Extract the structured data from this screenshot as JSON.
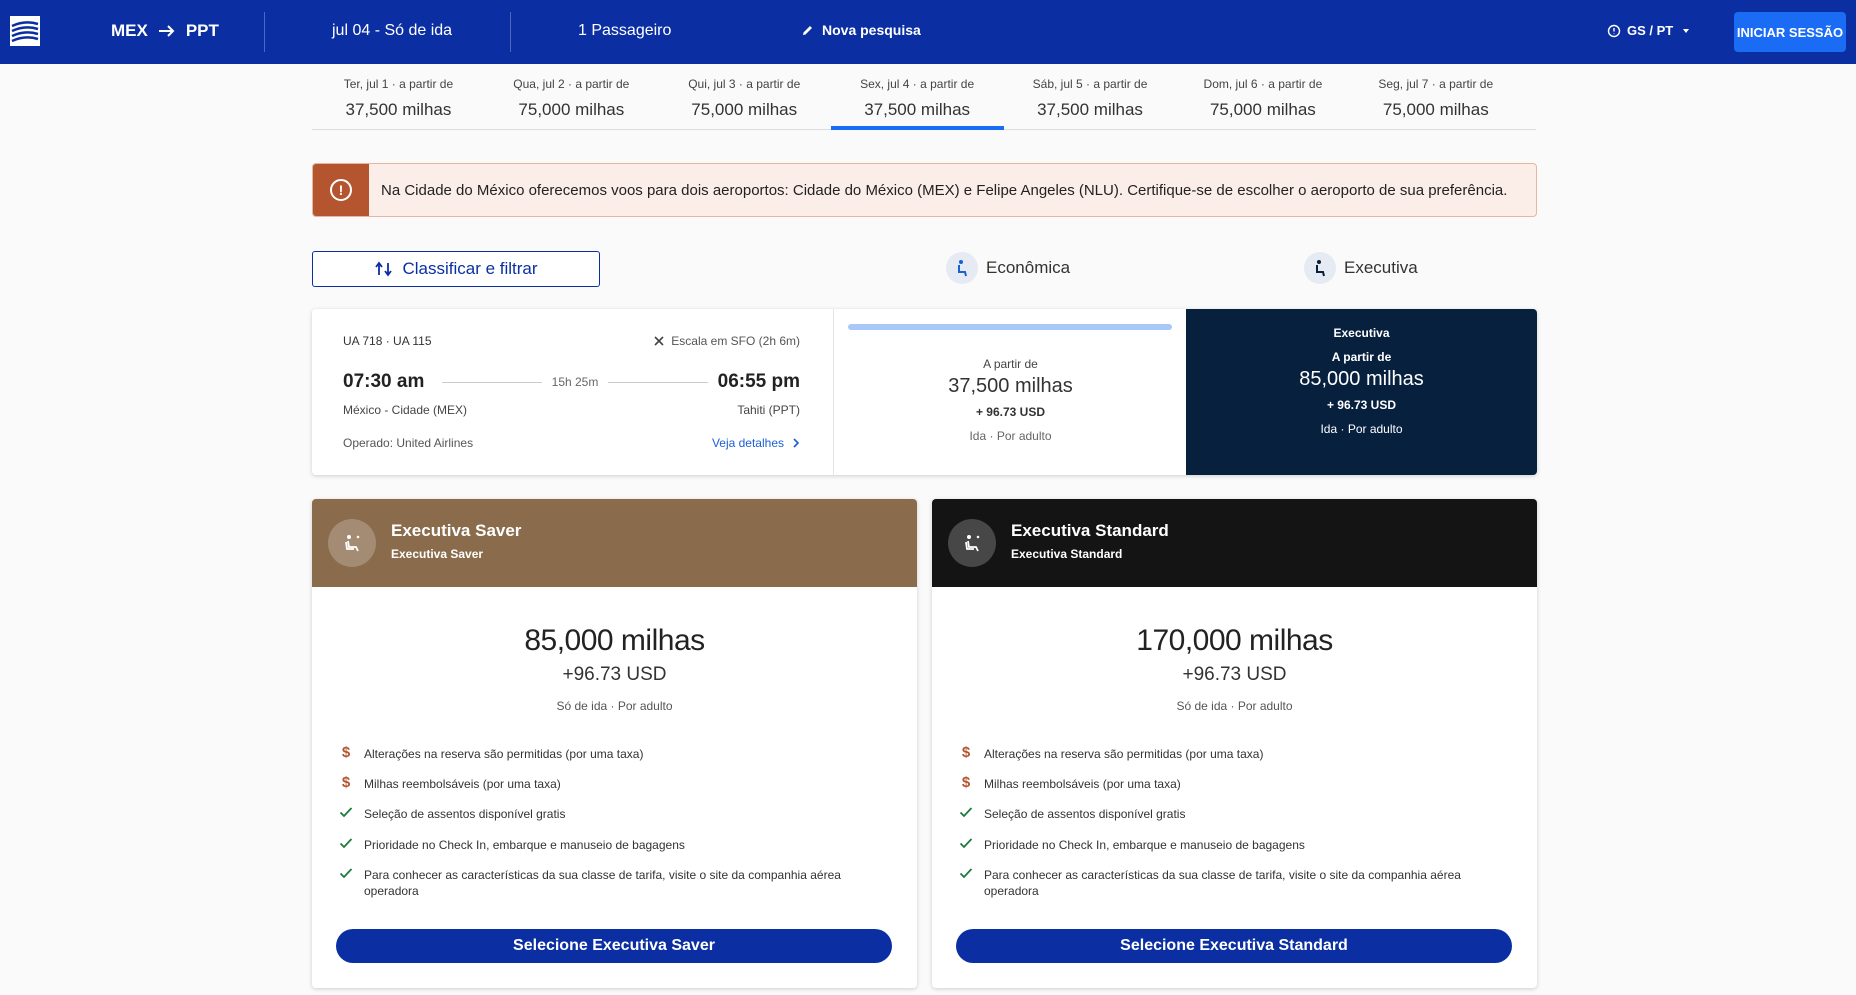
{
  "topbar": {
    "origin": "MEX",
    "destination": "PPT",
    "date_label": "jul 04 - Só de ida",
    "passengers": "1 Passageiro",
    "new_search": "Nova pesquisa",
    "locale": "GS / PT",
    "login": "INICIAR SESSÃO",
    "colors": {
      "bar": "#0b2fa3",
      "login": "#1a6cf5"
    }
  },
  "dates": [
    {
      "label": "Ter, jul 1 · a partir de",
      "miles": "37,500 milhas",
      "active": false
    },
    {
      "label": "Qua, jul 2 · a partir de",
      "miles": "75,000 milhas",
      "active": false
    },
    {
      "label": "Qui, jul 3 · a partir de",
      "miles": "75,000 milhas",
      "active": false
    },
    {
      "label": "Sex, jul 4 · a partir de",
      "miles": "37,500 milhas",
      "active": true
    },
    {
      "label": "Sáb, jul 5 · a partir de",
      "miles": "37,500 milhas",
      "active": false
    },
    {
      "label": "Dom, jul 6 · a partir de",
      "miles": "75,000 milhas",
      "active": false
    },
    {
      "label": "Seg, jul 7 · a partir de",
      "miles": "75,000 milhas",
      "active": false
    }
  ],
  "alert": {
    "text": "Na Cidade do México oferecemos voos para dois aeroportos: Cidade do México (MEX) e Felipe Angeles (NLU). Certifique-se de escolher o aeroporto de sua preferência.",
    "icon": "exclamation-circle-icon"
  },
  "controls": {
    "sort_filter": "Classificar e filtrar",
    "cabin_economy": "Econômica",
    "cabin_executive": "Executiva"
  },
  "flight": {
    "flights": "UA 718 · UA 115",
    "stop": "Escala em SFO (2h 6m)",
    "departure_time": "07:30 am",
    "arrival_time": "06:55 pm",
    "duration": "15h 25m",
    "from": "México - Cidade (MEX)",
    "to": "Tahiti (PPT)",
    "operated_by": "Operado: United Airlines",
    "details_link": "Veja detalhes",
    "economy": {
      "from_label": "A partir de",
      "miles": "37,500 milhas",
      "usd": "+ 96.73 USD",
      "sub": "Ida · Por adulto"
    },
    "executive": {
      "title": "Executiva",
      "from_label": "A partir de",
      "miles": "85,000 milhas",
      "usd": "+ 96.73 USD",
      "sub": "Ida · Por adulto"
    }
  },
  "fares": [
    {
      "title": "Executiva Saver",
      "subtitle": "Executiva Saver",
      "header_color": "#8a6c4c",
      "miles": "85,000 milhas",
      "usd": "+96.73 USD",
      "sub": "Só de ida · Por adulto",
      "features": [
        {
          "icon": "dollar-icon",
          "text": "Alterações na reserva são permitidas (por uma taxa)"
        },
        {
          "icon": "dollar-icon",
          "text": "Milhas reembolsáveis (por uma taxa)"
        },
        {
          "icon": "check-icon",
          "text": "Seleção de assentos disponível gratis"
        },
        {
          "icon": "check-icon",
          "text": "Prioridade no Check In, embarque e manuseio de bagagens"
        },
        {
          "icon": "check-icon",
          "text": "Para conhecer as características da sua classe de tarifa, visite o site da companhia aérea operadora"
        }
      ],
      "button": "Selecione Executiva Saver"
    },
    {
      "title": "Executiva Standard",
      "subtitle": "Executiva Standard",
      "header_color": "#141414",
      "miles": "170,000 milhas",
      "usd": "+96.73 USD",
      "sub": "Só de ida · Por adulto",
      "features": [
        {
          "icon": "dollar-icon",
          "text": "Alterações na reserva são permitidas (por uma taxa)"
        },
        {
          "icon": "dollar-icon",
          "text": "Milhas reembolsáveis (por uma taxa)"
        },
        {
          "icon": "check-icon",
          "text": "Seleção de assentos disponível gratis"
        },
        {
          "icon": "check-icon",
          "text": "Prioridade no Check In, embarque e manuseio de bagagens"
        },
        {
          "icon": "check-icon",
          "text": "Para conhecer as características da sua classe de tarifa, visite o site da companhia aérea operadora"
        }
      ],
      "button": "Selecione Executiva Standard"
    }
  ]
}
